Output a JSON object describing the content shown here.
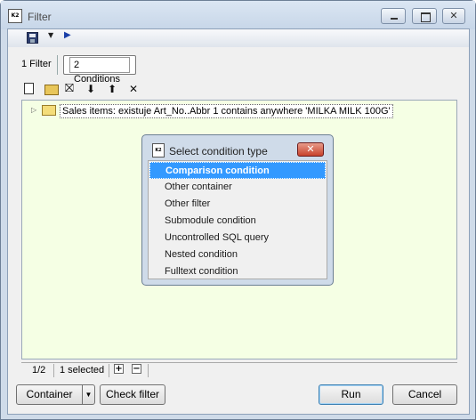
{
  "window": {
    "title": "Filter"
  },
  "tabs": [
    "1 Filter",
    "2 Conditions"
  ],
  "tree": {
    "item_label": "Sales items: existuje Art_No..Abbr 1 contains anywhere 'MILKA MILK 100G'"
  },
  "status": {
    "position": "1/2",
    "selected": "1 selected",
    "expand": "+",
    "collapse": "−"
  },
  "buttons": {
    "container": "Container",
    "check_filter": "Check filter",
    "run": "Run",
    "cancel": "Cancel"
  },
  "dialog": {
    "title": "Select condition type",
    "close": "✕",
    "options": [
      "Comparison condition",
      "Other container",
      "Other filter",
      "Submodule condition",
      "Uncontrolled SQL query",
      "Nested condition",
      "Fulltext condition"
    ]
  },
  "icons": {
    "app_icon_text": "K2",
    "new": "new-icon",
    "open": "open-folder-icon",
    "delete": "delete-icon",
    "down": "arrow-down-icon",
    "up": "arrow-up-icon",
    "clear": "clear-icon"
  }
}
